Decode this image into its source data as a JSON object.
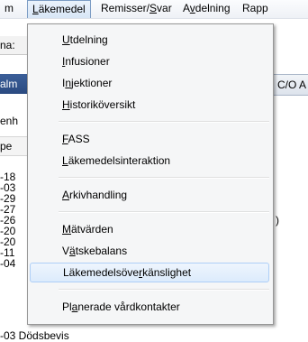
{
  "menubar": {
    "items": [
      {
        "label": "m",
        "underline_idx": -1
      },
      {
        "label": "Läkemedel",
        "underline_idx": 0
      },
      {
        "label": "Remisser/Svar",
        "underline_idx": 9
      },
      {
        "label": "Avdelning",
        "underline_idx": 1
      },
      {
        "label": "Rapp",
        "underline_idx": -1
      }
    ]
  },
  "background": {
    "tab1": "na:",
    "tab2": "alm",
    "label1": "enh",
    "label2": "pe",
    "right_header": "C/O A",
    "right_paren": ")",
    "list_fragments": [
      "-18",
      "-03",
      "-29",
      "-27",
      "-26",
      "-20",
      "-20",
      "-11",
      "-04"
    ],
    "bottom_text": "-03 Dödsbevis"
  },
  "dropdown": {
    "groups": [
      [
        {
          "label": "Utdelning",
          "mnemonic_idx": 0
        },
        {
          "label": "Infusioner",
          "mnemonic_idx": 0
        },
        {
          "label": "Injektioner",
          "mnemonic_idx": 1
        },
        {
          "label": "Historiköversikt",
          "mnemonic_idx": 0
        }
      ],
      [
        {
          "label": "FASS",
          "mnemonic_idx": 0
        },
        {
          "label": "Läkemedelsinteraktion",
          "mnemonic_idx": 0
        }
      ],
      [
        {
          "label": "Arkivhandling",
          "mnemonic_idx": 0
        }
      ],
      [
        {
          "label": "Mätvärden",
          "mnemonic_idx": 0
        },
        {
          "label": "Vätskebalans",
          "mnemonic_idx": 1
        },
        {
          "label": "Läkemedelsöverkänslighet",
          "mnemonic_idx": 13,
          "highlighted": true
        }
      ],
      [
        {
          "label": "Planerade vårdkontakter",
          "mnemonic_idx": 2
        }
      ]
    ]
  }
}
